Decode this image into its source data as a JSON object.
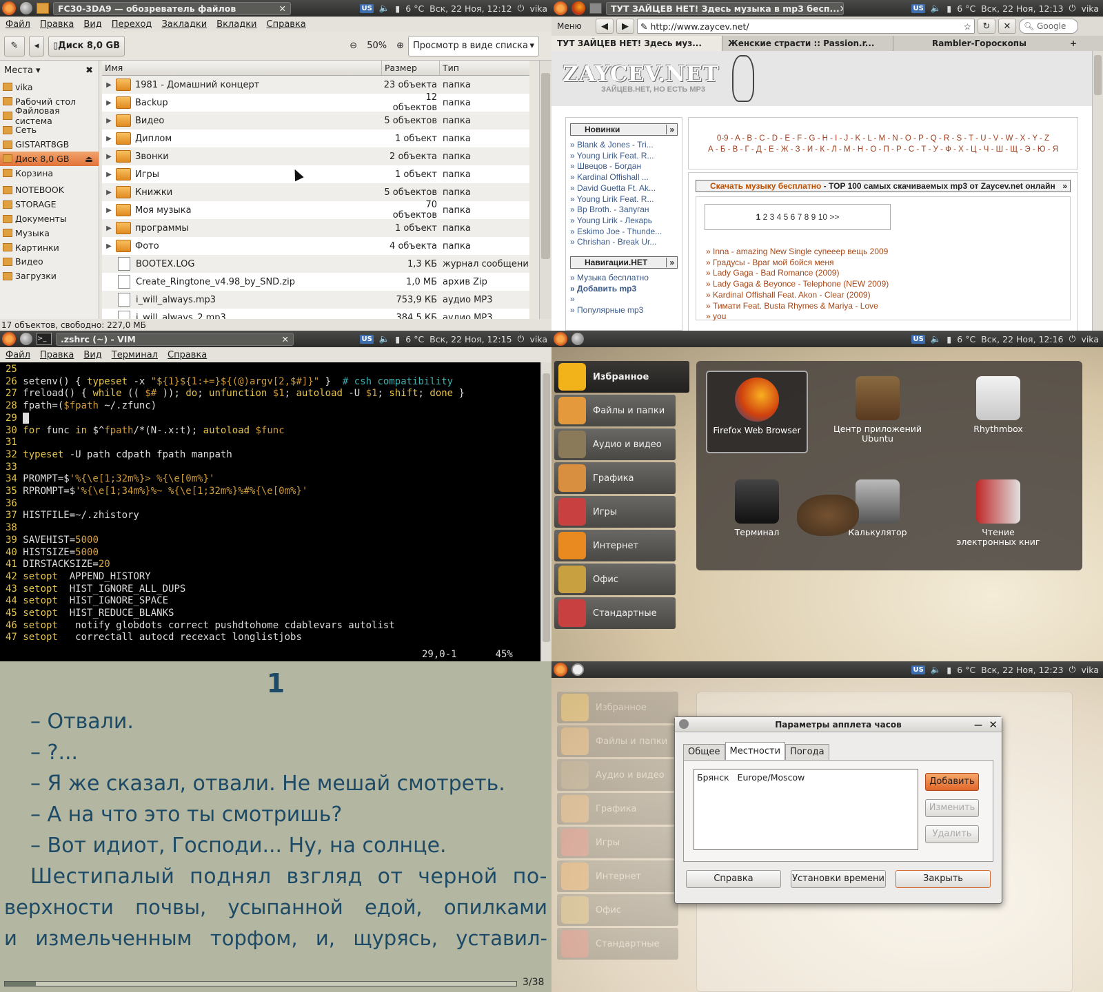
{
  "panels": {
    "weather": "6 °C",
    "user": "vika",
    "kbd": "US",
    "q1": {
      "title": "FC30-3DA9 — обозреватель файлов",
      "time": "Вск, 22 Ноя, 12:12"
    },
    "q2": {
      "title": "ТУТ ЗАЙЦЕВ НЕТ! Здесь музыка в mp3 бесп...",
      "time": "Вск, 22 Ноя, 12:13"
    },
    "q3": {
      "title": ".zshrc (~) - VIM",
      "time": "Вск, 22 Ноя, 12:15"
    },
    "q4": {
      "time": "Вск, 22 Ноя, 12:16"
    },
    "q6": {
      "time": "Вск, 22 Ноя, 12:23"
    }
  },
  "fm": {
    "menu": [
      "Файл",
      "Правка",
      "Вид",
      "Переход",
      "Закладки",
      "Вкладки",
      "Справка"
    ],
    "disk_button": "Диск 8,0 GB",
    "zoom": "50%",
    "view_mode": "Просмотр в виде списка",
    "places_label": "Места",
    "places": [
      "vika",
      "Рабочий стол",
      "Файловая система",
      "Сеть",
      "GISTART8GB",
      "Диск 8,0 GB",
      "Корзина",
      "NOTEBOOK",
      "STORAGE",
      "Документы",
      "Музыка",
      "Картинки",
      "Видео",
      "Загрузки"
    ],
    "cols": [
      "Имя",
      "Размер",
      "Тип"
    ],
    "rows": [
      {
        "name": "1981 - Домашний концерт",
        "size": "23 объекта",
        "type": "папка"
      },
      {
        "name": "Backup",
        "size": "12 объектов",
        "type": "папка"
      },
      {
        "name": "Видео",
        "size": "5 объектов",
        "type": "папка"
      },
      {
        "name": "Диплом",
        "size": "1 объект",
        "type": "папка"
      },
      {
        "name": "Звонки",
        "size": "2 объекта",
        "type": "папка"
      },
      {
        "name": "Игры",
        "size": "1 объект",
        "type": "папка"
      },
      {
        "name": "Книжки",
        "size": "5 объектов",
        "type": "папка"
      },
      {
        "name": "Моя музыка",
        "size": "70 объектов",
        "type": "папка"
      },
      {
        "name": "программы",
        "size": "1 объект",
        "type": "папка"
      },
      {
        "name": "Фото",
        "size": "4 объекта",
        "type": "папка"
      },
      {
        "name": "BOOTEX.LOG",
        "size": "1,3 КБ",
        "type": "журнал сообщений"
      },
      {
        "name": "Create_Ringtone_v4.98_by_SND.zip",
        "size": "1,0 МБ",
        "type": "архив Zip"
      },
      {
        "name": "i_will_always.mp3",
        "size": "753,9 КБ",
        "type": "аудио MP3"
      },
      {
        "name": "i_will_always_2.mp3",
        "size": "384,5 КБ",
        "type": "аудио MP3"
      }
    ],
    "status": "17 объектов, свободно: 227,0 МБ"
  },
  "browser": {
    "menu_label": "Меню",
    "url": "http://www.zaycev.net/",
    "search_placeholder": "Google",
    "tabs": [
      "ТУТ ЗАЙЦЕВ НЕТ! Здесь муз...",
      "Женские страсти :: Passion.r...",
      "Rambler-Гороскопы"
    ],
    "logo": "ZAYCEV.NET",
    "slogan": "ЗАЙЦЕВ.НЕТ, НО ЕСТЬ MP3",
    "new_header": "Новинки",
    "new_items": [
      "Blank & Jones - Tri...",
      "Young Lirik Feat. R...",
      "Швецов - Богдан",
      "Kardinal Offishall ...",
      "David Guetta Ft. Ak...",
      "Young Lirik Feat. R...",
      "Bp Broth. - Запуган",
      "Young Lirik - Лекарь",
      "Eskimo Joe - Thunde...",
      "Chrishan - Break Ur..."
    ],
    "nav_header": "Навигации.НЕТ",
    "nav_items": [
      "Музыка бесплатно",
      "Добавить mp3",
      "",
      "Популярные mp3"
    ],
    "alpha_latin": "0-9 - A - B - C - D - E - F - G - H - I - J - K - L - M - N - O - P - Q - R - S - T - U - V - W - X - Y - Z",
    "alpha_cyr": "А - Б - В - Г - Д - Е - Ж - З - И - К - Л - М - Н - О - П - Р - С - Т - У - Ф - Х - Ц - Ч - Ш - Щ - Э - Ю - Я",
    "top_link": "Скачать музыку бесплатно",
    "top_text": " - TOP 100 самых скачиваемых mp3 от Zaycev.net онлайн",
    "pages": "2 3 4 5 6 7 8 9 10 >>",
    "page_current": "1",
    "top_items": [
      "Inna - amazing New Single супееер вещь 2009",
      "Градусы - Враг мой бойся меня",
      "Lady Gaga - Bad Romance (2009)",
      "Lady Gaga & Beyonce - Telephone (NEW 2009)",
      "Kardinal Offishall Feat. Akon - Clear (2009)",
      "Тимати Feat. Busta Rhymes & Mariya - Love",
      "you"
    ]
  },
  "vim": {
    "menu": [
      "Файл",
      "Правка",
      "Вид",
      "Терминал",
      "Справка"
    ],
    "ruler": "29,0-1",
    "percent": "45%"
  },
  "launcher": {
    "categories": [
      "Избранное",
      "Файлы и папки",
      "Аудио и видео",
      "Графика",
      "Игры",
      "Интернет",
      "Офис",
      "Стандартные"
    ],
    "apps": [
      "Firefox Web Browser",
      "Центр приложений Ubuntu",
      "Rhythmbox",
      "Терминал",
      "Калькулятор",
      "Чтение электронных книг"
    ]
  },
  "reader": {
    "chapter": "1",
    "lines": [
      "– Отвали.",
      "– ?...",
      "– Я же сказал, отвали. Не мешай смотреть.",
      "– А на что это ты смотришь?",
      "– Вот идиот, Господи... Ну, на солнце.",
      "Шестипалый поднял взгляд от черной по-",
      "верхности почвы, усыпанной едой, опилками",
      "и измельченным торфом, и, щурясь, уставил-"
    ],
    "page": "3/38",
    "progress": 0.06
  },
  "clock": {
    "title": "Параметры апплета часов",
    "tabs": [
      "Общее",
      "Местности",
      "Погода"
    ],
    "loc_city": "Брянск",
    "loc_tz": "Europe/Moscow",
    "add": "Добавить",
    "edit": "Изменить",
    "remove": "Удалить",
    "help": "Справка",
    "set_time": "Установки времени",
    "close": "Закрыть"
  }
}
